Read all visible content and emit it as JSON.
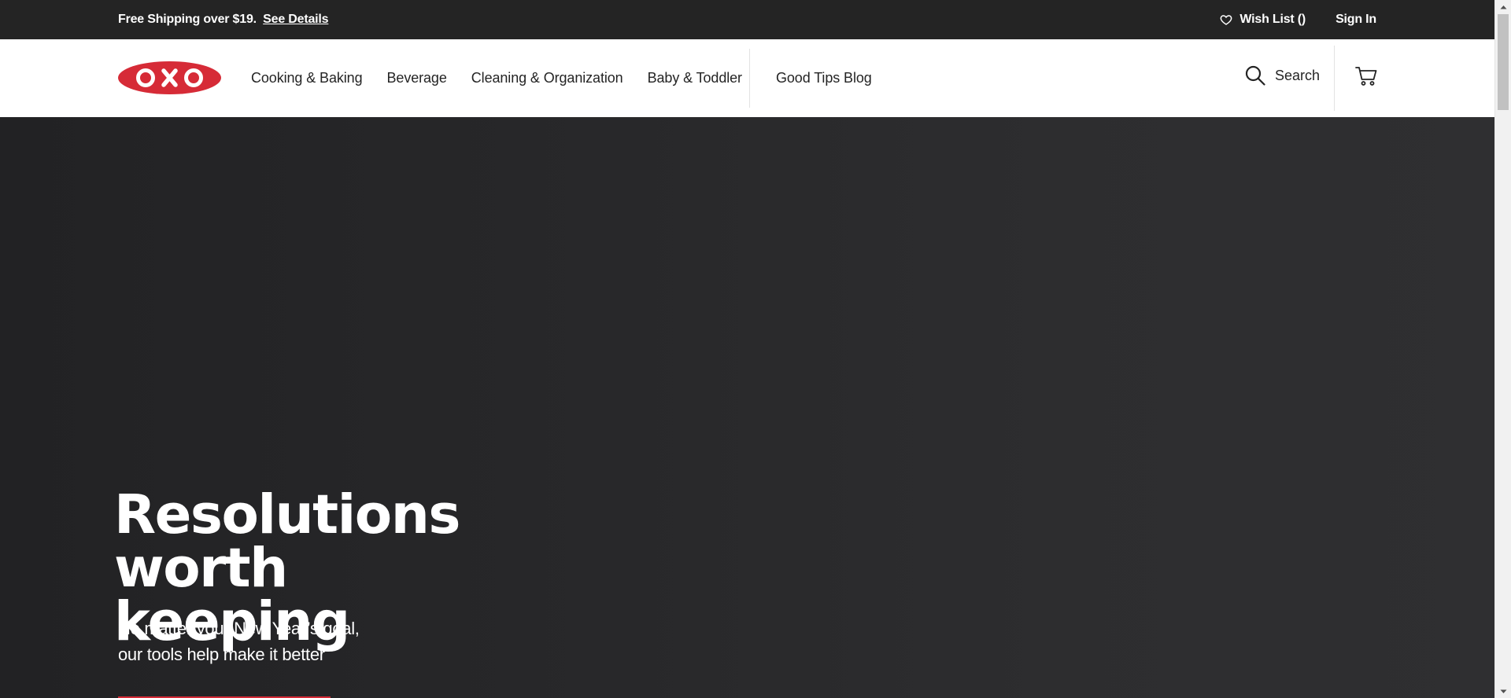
{
  "promo": {
    "text": "Free Shipping over $19.",
    "link": "See Details"
  },
  "utility": {
    "wishlist": "Wish List ()",
    "signin": "Sign In"
  },
  "header": {
    "logo_text": "OXO",
    "nav": [
      {
        "label": "Cooking & Baking"
      },
      {
        "label": "Beverage"
      },
      {
        "label": "Cleaning & Organization"
      },
      {
        "label": "Baby & Toddler"
      }
    ],
    "blog": "Good Tips Blog",
    "search_label": "Search"
  },
  "hero": {
    "title_line1": "Resolutions",
    "title_line2": "worth keeping",
    "subtitle_line1": "No matter your New Year’s goal,",
    "subtitle_line2": "our tools help make it better"
  },
  "colors": {
    "brand_red": "#d62b37",
    "promo_bg": "#242424",
    "hero_bg": "#2a2a2c"
  },
  "icons": [
    "heart-icon",
    "search-icon",
    "cart-icon",
    "oxo-logo"
  ]
}
